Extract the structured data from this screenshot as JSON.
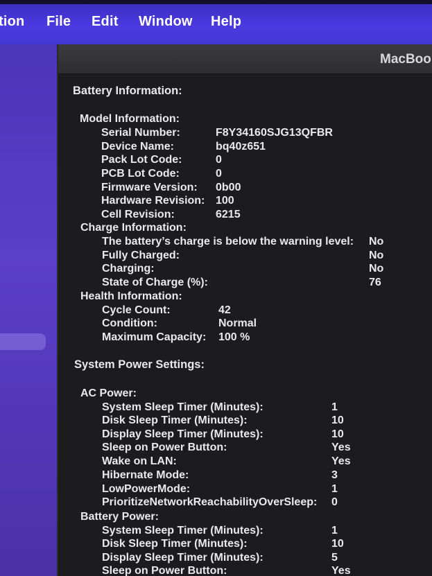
{
  "menubar": {
    "items": [
      "tion",
      "File",
      "Edit",
      "Window",
      "Help"
    ]
  },
  "window": {
    "title": "MacBoo"
  },
  "battery_information": {
    "heading": "Battery Information:",
    "model_information": {
      "heading": "Model Information:",
      "rows": [
        {
          "label": "Serial Number:",
          "value": "F8Y34160SJG13QFBR"
        },
        {
          "label": "Device Name:",
          "value": "bq40z651"
        },
        {
          "label": "Pack Lot Code:",
          "value": "0"
        },
        {
          "label": "PCB Lot Code:",
          "value": "0"
        },
        {
          "label": "Firmware Version:",
          "value": "0b00"
        },
        {
          "label": "Hardware Revision:",
          "value": "100"
        },
        {
          "label": "Cell Revision:",
          "value": "6215"
        }
      ]
    },
    "charge_information": {
      "heading": "Charge Information:",
      "rows": [
        {
          "label": "The battery’s charge is below the warning level:",
          "value": "No"
        },
        {
          "label": "Fully Charged:",
          "value": "No"
        },
        {
          "label": "Charging:",
          "value": "No"
        },
        {
          "label": "State of Charge (%):",
          "value": "76"
        }
      ]
    },
    "health_information": {
      "heading": "Health Information:",
      "rows": [
        {
          "label": "Cycle Count:",
          "value": "42"
        },
        {
          "label": "Condition:",
          "value": "Normal"
        },
        {
          "label": "Maximum Capacity:",
          "value": "100 %"
        }
      ]
    }
  },
  "system_power_settings": {
    "heading": "System Power Settings:",
    "ac_power": {
      "heading": "AC Power:",
      "rows": [
        {
          "label": "System Sleep Timer (Minutes):",
          "value": "1"
        },
        {
          "label": "Disk Sleep Timer (Minutes):",
          "value": "10"
        },
        {
          "label": "Display Sleep Timer (Minutes):",
          "value": "10"
        },
        {
          "label": "Sleep on Power Button:",
          "value": "Yes"
        },
        {
          "label": "Wake on LAN:",
          "value": "Yes"
        },
        {
          "label": "Hibernate Mode:",
          "value": "3"
        },
        {
          "label": "LowPowerMode:",
          "value": "1"
        },
        {
          "label": "PrioritizeNetworkReachabilityOverSleep:",
          "value": "0"
        }
      ]
    },
    "battery_power": {
      "heading": "Battery Power:",
      "rows": [
        {
          "label": "System Sleep Timer (Minutes):",
          "value": "1"
        },
        {
          "label": "Disk Sleep Timer (Minutes):",
          "value": "10"
        },
        {
          "label": "Display Sleep Timer (Minutes):",
          "value": "5"
        },
        {
          "label": "Sleep on Power Button:",
          "value": "Yes"
        }
      ]
    }
  },
  "colors": {
    "menubar": "#4337d4",
    "desktop": "#5a3fc8",
    "window_bg": "#1c1b1e",
    "text": "#e9e9ee"
  }
}
